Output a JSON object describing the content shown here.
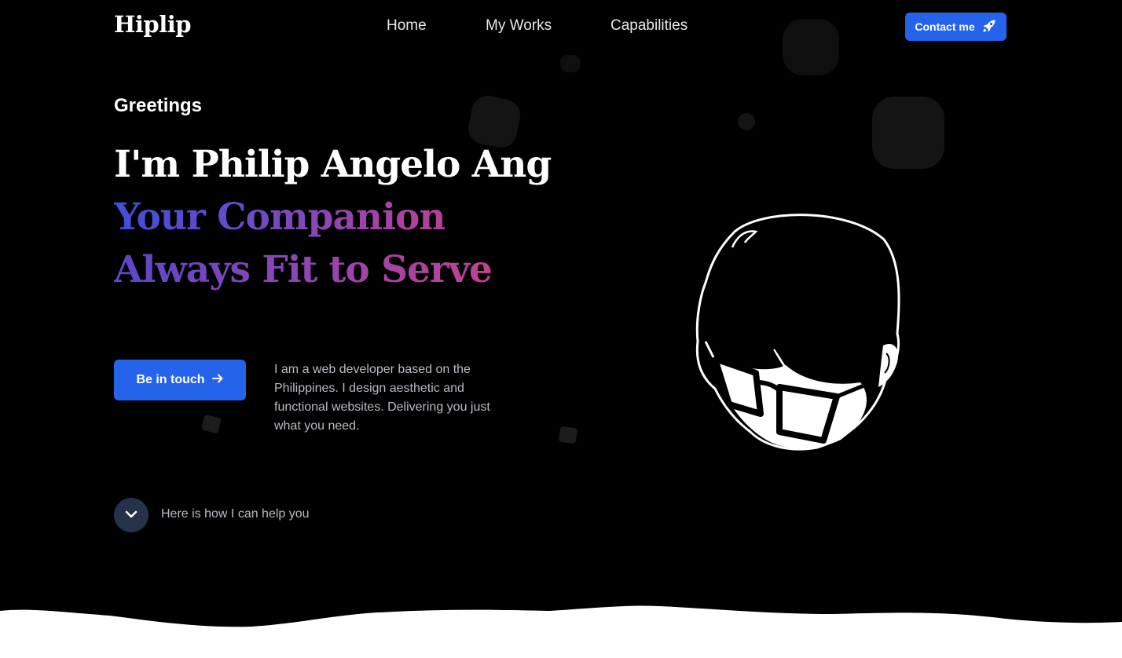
{
  "brand": {
    "logo": "Hiplip"
  },
  "nav": {
    "items": [
      {
        "label": "Home"
      },
      {
        "label": "My Works"
      },
      {
        "label": "Capabilities"
      }
    ],
    "contact_label": "Contact me",
    "contact_icon": "rocket-icon"
  },
  "hero": {
    "greeting": "Greetings",
    "name_line": "I'm Philip Angelo Ang",
    "tagline_1": "Your Companion",
    "tagline_2": "Always Fit to Serve",
    "cta_label": "Be in touch",
    "cta_icon": "arrow-right-icon",
    "description": "I am a web developer based on the Philippines. I design aesthetic and functional websites. Delivering you just what you need.",
    "scroll_label": "Here is how I can help you",
    "scroll_icon": "chevron-down-icon"
  },
  "colors": {
    "background": "#000000",
    "accent": "#2563eb",
    "gradient_start": "#3f4fd8",
    "gradient_end": "#c2418f",
    "muted_text": "#b8bcc4",
    "scroll_button": "#25324a"
  }
}
